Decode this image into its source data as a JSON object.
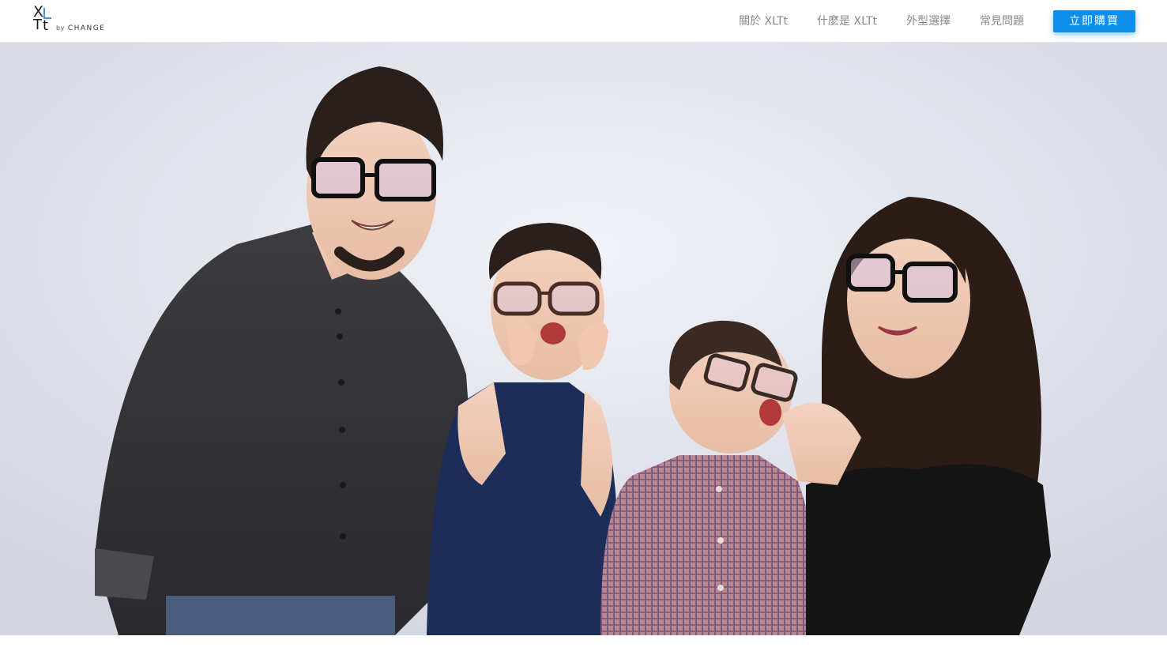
{
  "brand": {
    "logo_letters": "XLTt",
    "byline_by": "by",
    "byline_name": "CHANGE",
    "accent_color": "#2a9df4"
  },
  "nav": {
    "items": [
      {
        "label": "關於 XLTt"
      },
      {
        "label": "什麼是 XLTt"
      },
      {
        "label": "外型選擇"
      },
      {
        "label": "常見問題"
      }
    ],
    "cta_label": "立即購買",
    "cta_color": "#0e8ee9"
  },
  "hero": {
    "image": "family-photo-four-people-wearing-glasses"
  }
}
